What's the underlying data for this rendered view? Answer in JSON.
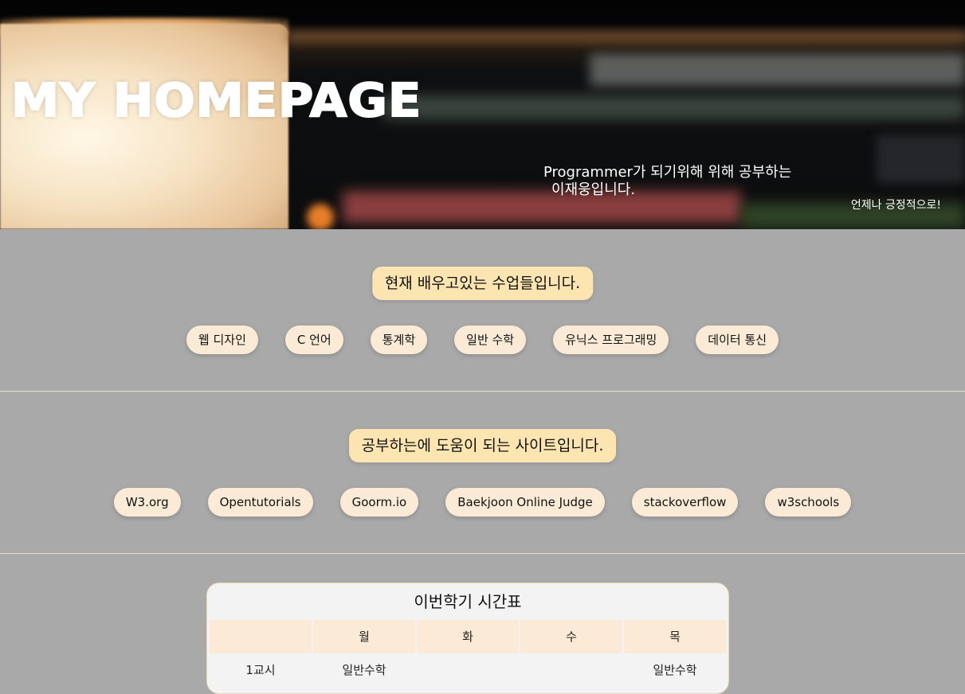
{
  "hero": {
    "title": "MY HOMEPAGE",
    "subtitle_line1": "Programmer가 되기위해 위해 공부하는",
    "subtitle_line2": "이재웅입니다.",
    "motto": "언제나 긍정적으로!"
  },
  "courses": {
    "heading": "현재 배우고있는 수업들입니다.",
    "items": [
      "웹 디자인",
      "C 언어",
      "통계학",
      "일반 수학",
      "유닉스 프로그래밍",
      "데이터 통신"
    ]
  },
  "sites": {
    "heading": "공부하는에 도움이 되는 사이트입니다.",
    "items": [
      "W3.org",
      "Opentutorials",
      "Goorm.io",
      "Baekjoon Online Judge",
      "stackoverflow",
      "w3schools"
    ]
  },
  "timetable": {
    "title": "이번학기 시간표",
    "header": [
      "",
      "월",
      "화",
      "수",
      "목"
    ],
    "first_row": [
      "1교시",
      "일반수학",
      "",
      "",
      "일반수학"
    ]
  },
  "colors": {
    "page_bg": "#a9a9a9",
    "heading_pill": "#fde5b2",
    "pill": "#fbebd6",
    "divider": "#eadfc6"
  }
}
